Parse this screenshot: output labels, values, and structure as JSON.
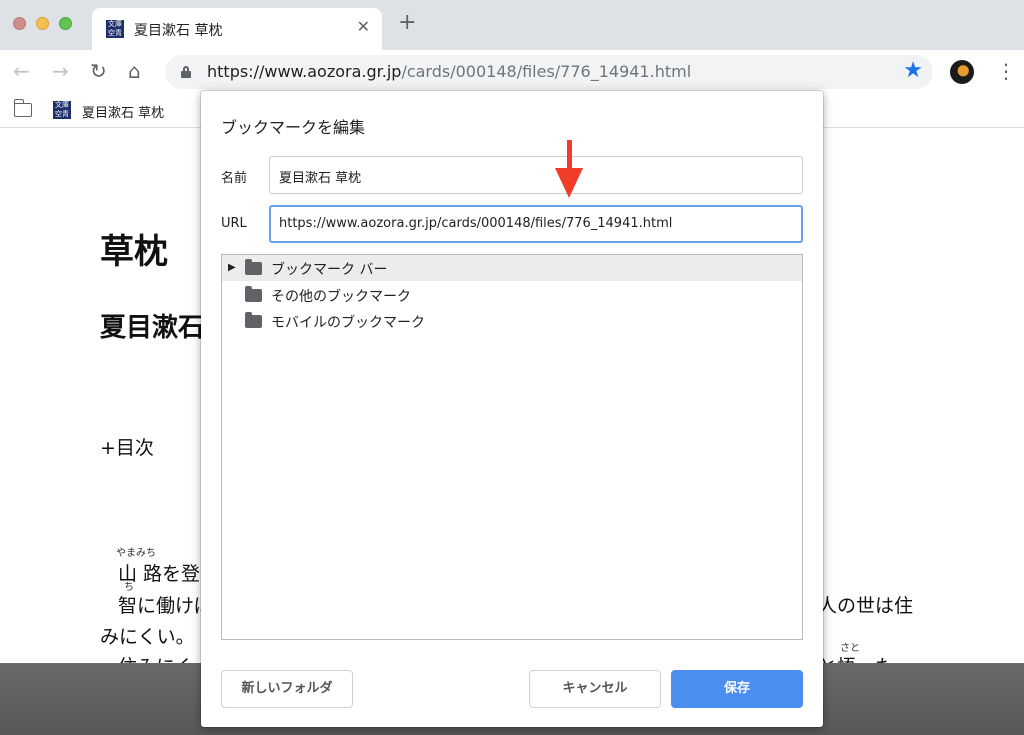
{
  "browser": {
    "tab": {
      "favicon_text": "文庫 空青",
      "title": "夏目漱石 草枕",
      "close_glyph": "✕"
    },
    "newtab_glyph": "+",
    "toolbar": {
      "back_glyph": "←",
      "forward_glyph": "→",
      "reload_glyph": "↻",
      "home_glyph": "⌂",
      "url_host": "https://www.aozora.gr.jp",
      "url_path": "/cards/000148/files/776_14941.html",
      "star_glyph": "★",
      "menu_glyph": "⋮"
    },
    "bookmarks_bar": {
      "favicon_text": "文庫 空青",
      "item_label": "夏目漱石 草枕"
    }
  },
  "page": {
    "title": "草枕",
    "author": "夏目漱石",
    "toc": "+目次",
    "ruby_1": "やまみち",
    "line_1": "山 路を登",
    "ruby_2": "ち",
    "line_2": "智に働けば",
    "line_2_right": "人の世は住",
    "line_3": "みにくい。",
    "line_4": "住みにく",
    "ruby_3": "さと",
    "line_4_right": "と悟った"
  },
  "dialog": {
    "title": "ブックマークを編集",
    "name_label": "名前",
    "name_value": "夏目漱石 草枕",
    "url_label": "URL",
    "url_value": "https://www.aozora.gr.jp/cards/000148/files/776_14941.html",
    "tree": [
      {
        "label": "ブックマーク バー",
        "expandable": true,
        "selected": true
      },
      {
        "label": "その他のブックマーク",
        "expandable": false,
        "selected": false
      },
      {
        "label": "モバイルのブックマーク",
        "expandable": false,
        "selected": false
      }
    ],
    "new_folder_button": "新しいフォルダ",
    "cancel_button": "キャンセル",
    "save_button": "保存"
  },
  "colors": {
    "primary_button": "#4a8ef0",
    "annotation_arrow": "#f23c2a",
    "star": "#1a73e8"
  }
}
